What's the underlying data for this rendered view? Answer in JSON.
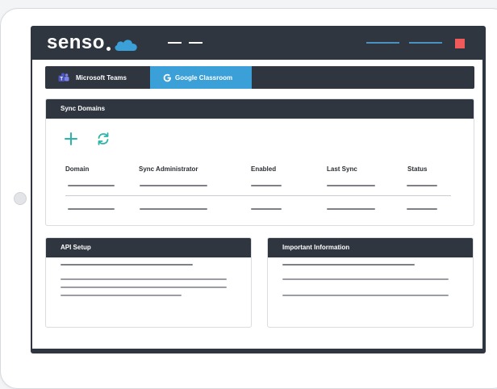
{
  "app": {
    "logo_text": "senso",
    "brand_color": "#3b9fd8",
    "close_color": "#f05a5a"
  },
  "tabs": [
    {
      "label": "Microsoft Teams",
      "icon": "teams-icon",
      "active": false
    },
    {
      "label": "Google Classroom",
      "icon": "google-icon",
      "active": true
    }
  ],
  "sync_panel": {
    "title": "Sync Domains",
    "actions": [
      {
        "name": "add",
        "icon": "plus-icon"
      },
      {
        "name": "refresh",
        "icon": "refresh-icon"
      }
    ],
    "columns": [
      "Domain",
      "Sync Administrator",
      "Enabled",
      "Last Sync",
      "Status"
    ]
  },
  "api_panel": {
    "title": "API Setup"
  },
  "info_panel": {
    "title": "Important Information"
  }
}
